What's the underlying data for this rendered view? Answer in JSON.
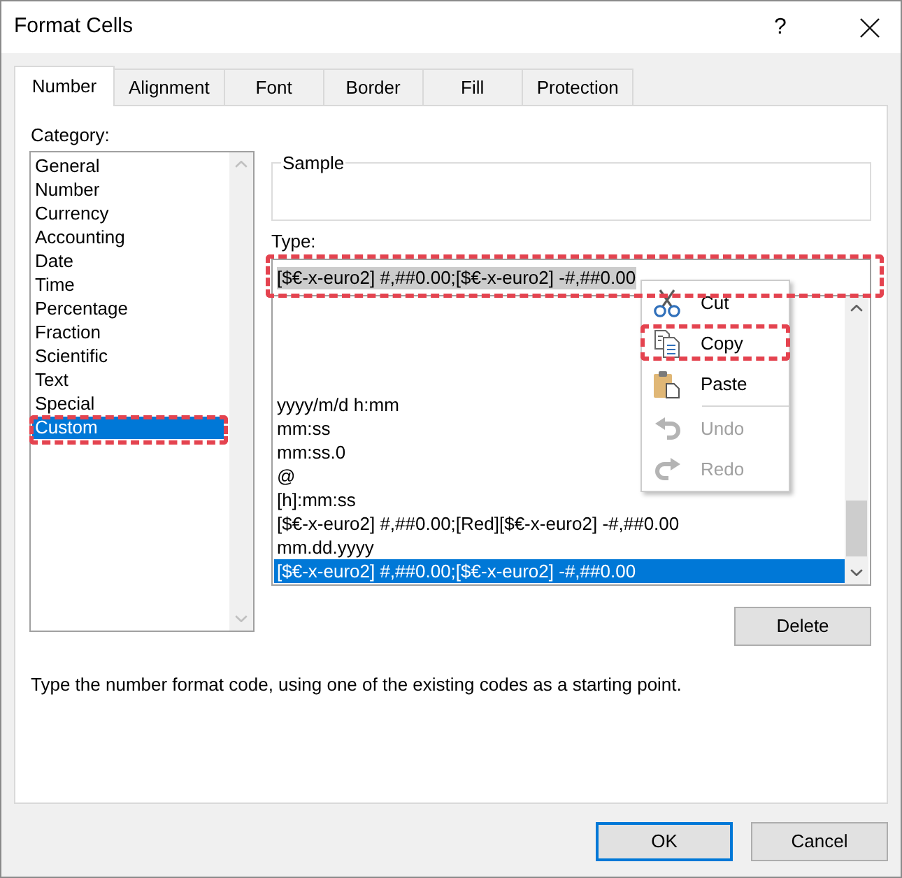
{
  "window": {
    "title": "Format Cells",
    "help_button": "?"
  },
  "tabs": [
    {
      "label": "Number",
      "selected": true
    },
    {
      "label": "Alignment",
      "selected": false
    },
    {
      "label": "Font",
      "selected": false
    },
    {
      "label": "Border",
      "selected": false
    },
    {
      "label": "Fill",
      "selected": false
    },
    {
      "label": "Protection",
      "selected": false
    }
  ],
  "category": {
    "label": "Category:",
    "items": [
      {
        "label": "General",
        "selected": false,
        "highlighted": false
      },
      {
        "label": "Number",
        "selected": false,
        "highlighted": false
      },
      {
        "label": "Currency",
        "selected": false,
        "highlighted": false
      },
      {
        "label": "Accounting",
        "selected": false,
        "highlighted": false
      },
      {
        "label": "Date",
        "selected": false,
        "highlighted": false
      },
      {
        "label": "Time",
        "selected": false,
        "highlighted": false
      },
      {
        "label": "Percentage",
        "selected": false,
        "highlighted": false
      },
      {
        "label": "Fraction",
        "selected": false,
        "highlighted": false
      },
      {
        "label": "Scientific",
        "selected": false,
        "highlighted": false
      },
      {
        "label": "Text",
        "selected": false,
        "highlighted": false
      },
      {
        "label": "Special",
        "selected": false,
        "highlighted": false
      },
      {
        "label": "Custom",
        "selected": true,
        "highlighted": true
      }
    ]
  },
  "sample": {
    "label": "Sample"
  },
  "type_field": {
    "label": "Type:",
    "value": "[$€-x-euro2] #,##0.00;[$€-x-euro2] -#,##0.00",
    "text_selected": true,
    "highlighted": true
  },
  "type_list": {
    "items": [
      {
        "label": "yyyy/m/d h:mm",
        "selected": false
      },
      {
        "label": "mm:ss",
        "selected": false
      },
      {
        "label": "mm:ss.0",
        "selected": false
      },
      {
        "label": "@",
        "selected": false
      },
      {
        "label": "[h]:mm:ss",
        "selected": false
      },
      {
        "label": "[$€-x-euro2] #,##0.00;[Red][$€-x-euro2] -#,##0.00",
        "selected": false
      },
      {
        "label": "mm.dd.yyyy",
        "selected": false
      },
      {
        "label": "[$€-x-euro2] #,##0.00;[$€-x-euro2] -#,##0.00",
        "selected": true
      }
    ]
  },
  "delete_button": "Delete",
  "description": "Type the number format code, using one of the existing codes as a starting point.",
  "buttons": [
    {
      "label": "OK",
      "default": true
    },
    {
      "label": "Cancel",
      "default": false
    }
  ],
  "context_menu": {
    "items": [
      {
        "kind": "item",
        "label": "Cut",
        "disabled": false,
        "highlighted": false
      },
      {
        "kind": "item",
        "label": "Copy",
        "disabled": false,
        "highlighted": true
      },
      {
        "kind": "item",
        "label": "Paste",
        "disabled": false,
        "highlighted": false
      },
      {
        "kind": "separator"
      },
      {
        "kind": "item",
        "label": "Undo",
        "disabled": true,
        "highlighted": false
      },
      {
        "kind": "item",
        "label": "Redo",
        "disabled": true,
        "highlighted": false
      }
    ]
  }
}
